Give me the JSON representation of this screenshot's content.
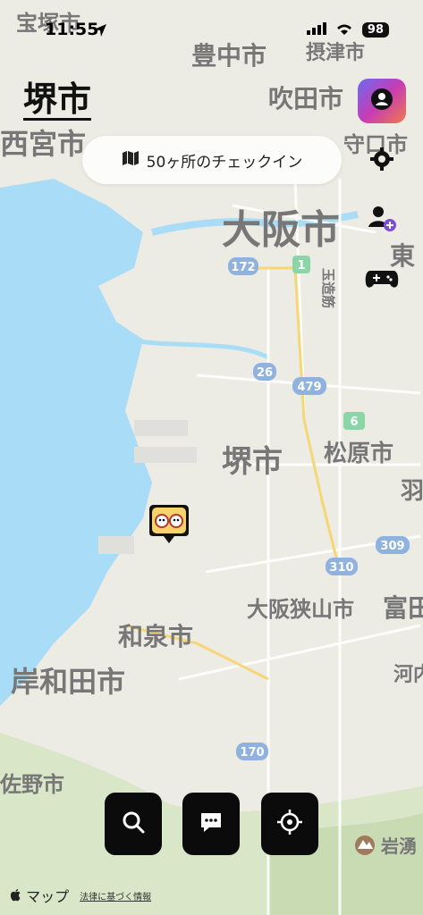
{
  "status": {
    "time": "11:55",
    "battery": "98"
  },
  "header": {
    "city_title": "堺市"
  },
  "checkin": {
    "label": "50ヶ所のチェックイン"
  },
  "map_labels": {
    "takarazuka": "宝塚市",
    "toyonaka": "豊中市",
    "settsu": "摂津市",
    "suita": "吹田市",
    "nishinomiya": "西宮市",
    "moriguchi": "守口市",
    "osaka": "大阪市",
    "higashi": "東",
    "sakai": "堺市",
    "matsubara": "松原市",
    "ha": "羽",
    "osakasayama": "大阪狭山市",
    "tomi": "富田",
    "izumi": "和泉市",
    "kishiwada": "岸和田市",
    "kawachi": "河内",
    "kaizuka": "佐野市",
    "iwawaki": "岩湧",
    "tamatsukuri": "玉造筋"
  },
  "road_shields": [
    "172",
    "1",
    "26",
    "479",
    "6",
    "309",
    "310",
    "170"
  ],
  "attribution": {
    "brand": "マップ",
    "legal": "法律に基づく情報"
  },
  "icons": [
    "location-arrow-icon",
    "signal-icon",
    "wifi-icon",
    "profile-icon",
    "gear-icon",
    "add-friend-icon",
    "gamepad-icon",
    "map-icon",
    "search-icon",
    "chat-icon",
    "locate-icon",
    "apple-icon",
    "mountain-icon"
  ],
  "colors": {
    "water": "#a9dcf7",
    "land": "#ecebe4",
    "button_dark": "#0b0b0b",
    "profile_gradient_start": "#6b6cf0",
    "profile_gradient_end": "#f07a4a"
  }
}
